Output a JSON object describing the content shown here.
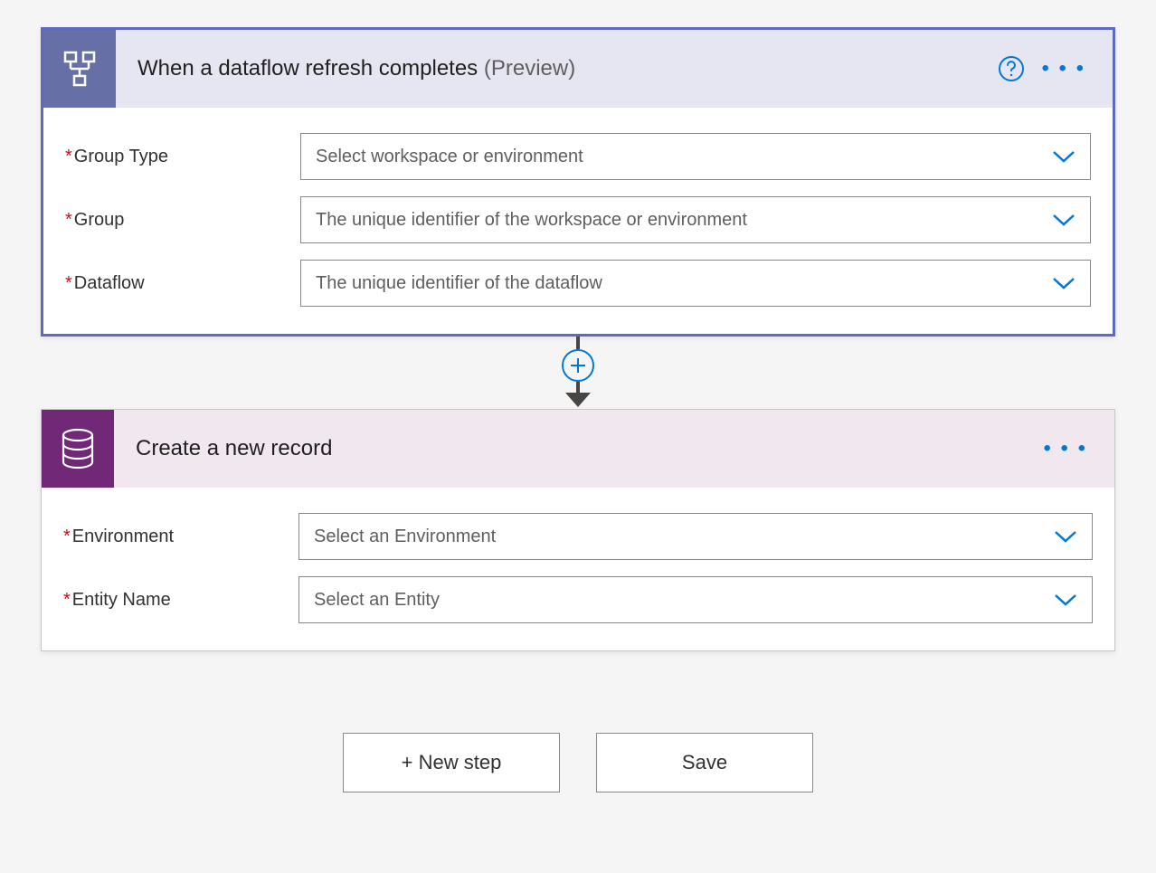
{
  "trigger": {
    "title": "When a dataflow refresh completes",
    "preview": "(Preview)",
    "fields": {
      "groupType": {
        "label": "Group Type",
        "placeholder": "Select workspace or environment"
      },
      "group": {
        "label": "Group",
        "placeholder": "The unique identifier of the workspace or environment"
      },
      "dataflow": {
        "label": "Dataflow",
        "placeholder": "The unique identifier of the dataflow"
      }
    }
  },
  "action": {
    "title": "Create a new record",
    "fields": {
      "environment": {
        "label": "Environment",
        "placeholder": "Select an Environment"
      },
      "entityName": {
        "label": "Entity Name",
        "placeholder": "Select an Entity"
      }
    }
  },
  "buttons": {
    "newStep": "+ New step",
    "save": "Save"
  }
}
